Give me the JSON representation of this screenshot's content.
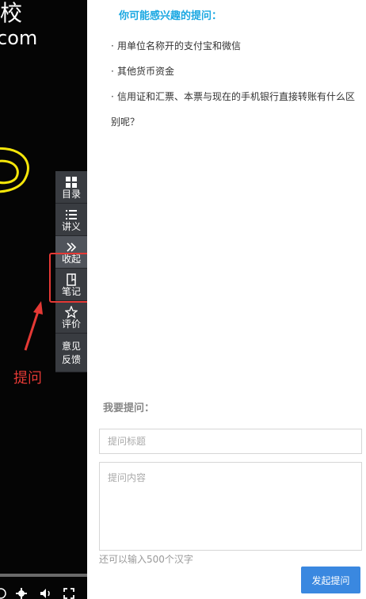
{
  "video": {
    "title_fragment": "网校",
    "subtitle_fragment": "com"
  },
  "toolbar": {
    "items": [
      {
        "label": "目录",
        "icon": "grid-icon"
      },
      {
        "label": "讲义",
        "icon": "list-icon"
      },
      {
        "label": "收起",
        "icon": "double-chevron-right-icon"
      },
      {
        "label": "笔记",
        "icon": "note-icon"
      },
      {
        "label": "评价",
        "icon": "star-icon"
      },
      {
        "label_line1": "意见",
        "label_line2": "反馈"
      }
    ]
  },
  "annotation": {
    "label": "提问",
    "color": "#e53935"
  },
  "questions": {
    "title": "你可能感兴趣的提问：",
    "items": [
      "用单位名称开的支付宝和微信",
      "其他货币资金",
      "信用证和汇票、本票与现在的手机银行直接转账有什么区别呢？"
    ]
  },
  "ask_form": {
    "label": "我要提问：",
    "title_placeholder": "提问标题",
    "content_placeholder": "提问内容",
    "hint": "还可以输入500个汉字",
    "submit_label": "发起提问"
  },
  "colors": {
    "accent": "#1ba8e2",
    "button": "#3a88e0",
    "toolbar": "#393c41"
  }
}
